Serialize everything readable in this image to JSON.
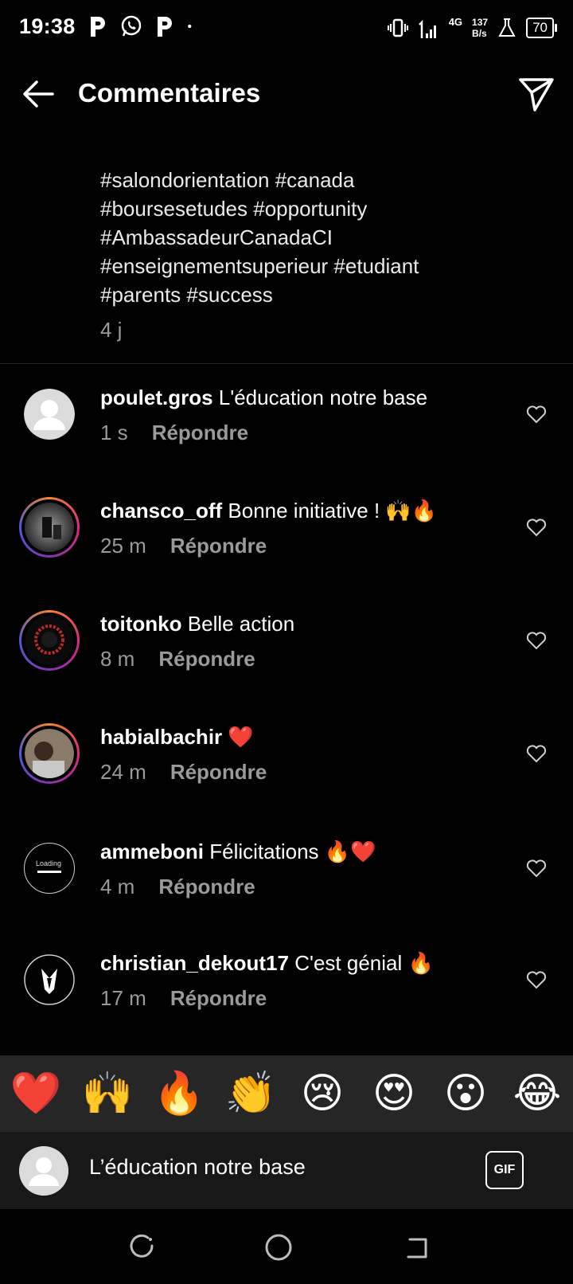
{
  "status": {
    "time": "19:38",
    "net": "4G",
    "speed_top": "137",
    "speed_bottom": "B/s",
    "battery": "70"
  },
  "header": {
    "title": "Commentaires"
  },
  "caption": {
    "lines": [
      "#salondorientation #canada",
      "#boursesetudes #opportunity",
      "#AmbassadeurCanadaCI",
      "#enseignementsuperieur #etudiant",
      "#parents #success"
    ],
    "age": "4 j"
  },
  "comments": [
    {
      "user": "poulet.gros",
      "text": "L'éducation notre base",
      "time": "1 s",
      "reply": "Répondre"
    },
    {
      "user": "chansco_off",
      "text": "Bonne initiative ! 🙌🔥",
      "time": "25 m",
      "reply": "Répondre"
    },
    {
      "user": "toitonko",
      "text": "Belle action",
      "time": "8 m",
      "reply": "Répondre"
    },
    {
      "user": "habialbachir",
      "text": "❤️",
      "time": "24 m",
      "reply": "Répondre"
    },
    {
      "user": "ammeboni",
      "text": "Félicitations 🔥❤️",
      "time": "4 m",
      "reply": "Répondre"
    },
    {
      "user": "christian_dekout17",
      "text": "C'est génial 🔥",
      "time": "17 m",
      "reply": "Répondre"
    }
  ],
  "emojis": [
    "❤️",
    "🙌",
    "🔥",
    "👏",
    "😢",
    "😍",
    "😮",
    "😂"
  ],
  "input": {
    "value": "L’éducation notre base",
    "gif": "GIF"
  },
  "avatar_texts": {
    "ammeboni": "Loading"
  }
}
